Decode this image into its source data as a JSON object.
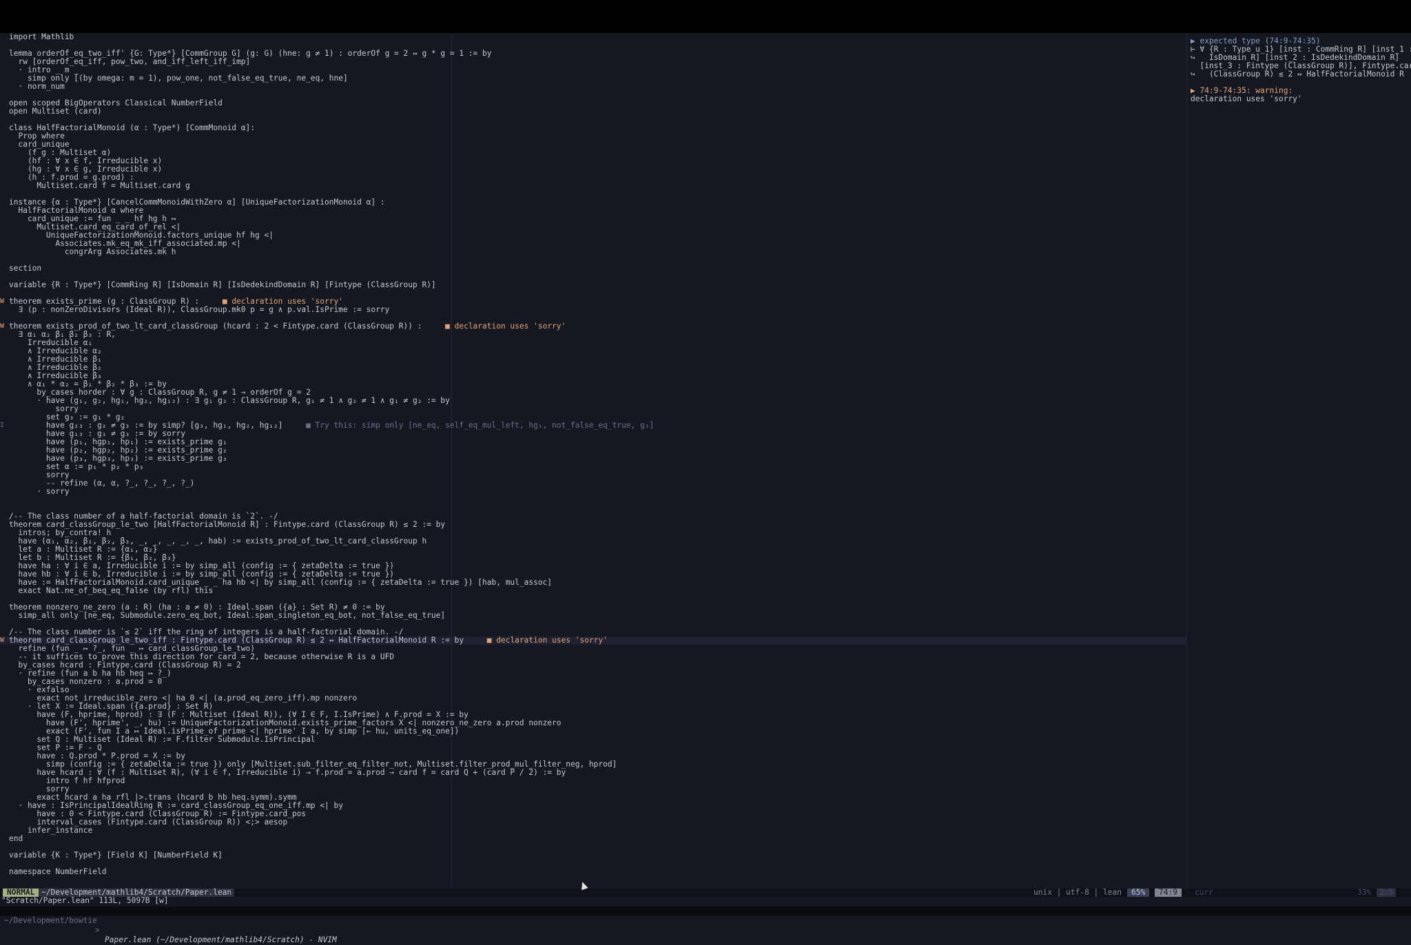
{
  "editor": {
    "lines": [
      {
        "s": "",
        "c": "import Mathlib",
        "d": ""
      },
      {
        "s": "",
        "c": "",
        "d": ""
      },
      {
        "s": "",
        "c": "lemma orderOf_eq_two_iff' {G: Type*} [CommGroup G] (g: G) (hne: g ≠ 1) : orderOf g = 2 ↔ g * g = 1 := by",
        "d": ""
      },
      {
        "s": "",
        "c": "  rw [orderOf_eq_iff, pow_two, and_iff_left_iff_imp]",
        "d": ""
      },
      {
        "s": "",
        "c": "  · intro _ m _",
        "d": ""
      },
      {
        "s": "",
        "c": "    simp only [(by omega: m = 1), pow_one, not_false_eq_true, ne_eq, hne]",
        "d": ""
      },
      {
        "s": "",
        "c": "  · norm_num",
        "d": ""
      },
      {
        "s": "",
        "c": "",
        "d": ""
      },
      {
        "s": "",
        "c": "open scoped BigOperators Classical NumberField",
        "d": ""
      },
      {
        "s": "",
        "c": "open Multiset (card)",
        "d": ""
      },
      {
        "s": "",
        "c": "",
        "d": ""
      },
      {
        "s": "",
        "c": "class HalfFactorialMonoid (α : Type*) [CommMonoid α]:",
        "d": ""
      },
      {
        "s": "",
        "c": "  Prop where",
        "d": ""
      },
      {
        "s": "",
        "c": "  card_unique",
        "d": ""
      },
      {
        "s": "",
        "c": "    (f g : Multiset α)",
        "d": ""
      },
      {
        "s": "",
        "c": "    (hf : ∀ x ∈ f, Irreducible x)",
        "d": ""
      },
      {
        "s": "",
        "c": "    (hg : ∀ x ∈ g, Irreducible x)",
        "d": ""
      },
      {
        "s": "",
        "c": "    (h : f.prod = g.prod) :",
        "d": ""
      },
      {
        "s": "",
        "c": "      Multiset.card f = Multiset.card g",
        "d": ""
      },
      {
        "s": "",
        "c": "",
        "d": ""
      },
      {
        "s": "",
        "c": "instance {α : Type*} [CancelCommMonoidWithZero α] [UniqueFactorizationMonoid α] :",
        "d": ""
      },
      {
        "s": "",
        "c": "  HalfFactorialMonoid α where",
        "d": ""
      },
      {
        "s": "",
        "c": "    card_unique := fun _ _ hf hg h ↦",
        "d": ""
      },
      {
        "s": "",
        "c": "      Multiset.card_eq_card_of_rel <|",
        "d": ""
      },
      {
        "s": "",
        "c": "        UniqueFactorizationMonoid.factors_unique hf hg <|",
        "d": ""
      },
      {
        "s": "",
        "c": "          Associates.mk_eq_mk_iff_associated.mp <|",
        "d": ""
      },
      {
        "s": "",
        "c": "            congrArg Associates.mk h",
        "d": ""
      },
      {
        "s": "",
        "c": "",
        "d": ""
      },
      {
        "s": "",
        "c": "section",
        "d": ""
      },
      {
        "s": "",
        "c": "",
        "d": ""
      },
      {
        "s": "",
        "c": "variable {R : Type*} [CommRing R] [IsDomain R] [IsDedekindDomain R] [Fintype (ClassGroup R)]",
        "d": ""
      },
      {
        "s": "",
        "c": "",
        "d": ""
      },
      {
        "s": "W",
        "c": "theorem exists_prime (g : ClassGroup R) :     ",
        "d": "■ declaration uses 'sorry'"
      },
      {
        "s": "",
        "c": "  ∃ (p : nonZeroDivisors (Ideal R)), ClassGroup.mk0 p = g ∧ p.val.IsPrime := sorry",
        "d": ""
      },
      {
        "s": "",
        "c": "",
        "d": ""
      },
      {
        "s": "W",
        "c": "theorem exists_prod_of_two_lt_card_classGroup (hcard : 2 < Fintype.card (ClassGroup R)) :     ",
        "d": "■ declaration uses 'sorry'"
      },
      {
        "s": "",
        "c": "  ∃ α₁ α₂ β₁ β₂ β₃ : R,",
        "d": ""
      },
      {
        "s": "",
        "c": "    Irreducible α₁",
        "d": ""
      },
      {
        "s": "",
        "c": "    ∧ Irreducible α₂",
        "d": ""
      },
      {
        "s": "",
        "c": "    ∧ Irreducible β₁",
        "d": ""
      },
      {
        "s": "",
        "c": "    ∧ Irreducible β₂",
        "d": ""
      },
      {
        "s": "",
        "c": "    ∧ Irreducible β₃",
        "d": ""
      },
      {
        "s": "",
        "c": "    ∧ α₁ * α₂ = β₁ * β₂ * β₃ := by",
        "d": ""
      },
      {
        "s": "",
        "c": "      by_cases horder : ∀ g : ClassGroup R, g ≠ 1 → orderOf g = 2",
        "d": ""
      },
      {
        "s": "",
        "c": "      · have (g₁, g₂, hg₁, hg₂, hg₁₂) : ∃ g₁ g₂ : ClassGroup R, g₁ ≠ 1 ∧ g₂ ≠ 1 ∧ g₁ ≠ g₂ := by",
        "d": ""
      },
      {
        "s": "",
        "c": "          sorry",
        "d": ""
      },
      {
        "s": "",
        "c": "        set g₃ := g₁ * g₂",
        "d": ""
      },
      {
        "s": "I",
        "c": "        have g₂₃ : g₂ ≠ g₃ := by simp? [g₃, hg₁, hg₂, hg₁₂]     ",
        "d": "■ Try this: simp only [ne_eq, self_eq_mul_left, hg₁, not_false_eq_true, g₃]"
      },
      {
        "s": "",
        "c": "        have g₁₃ : g₁ ≠ g₃ := by sorry",
        "d": ""
      },
      {
        "s": "",
        "c": "        have (p₁, hgp₁, hp₁) := exists_prime g₁",
        "d": ""
      },
      {
        "s": "",
        "c": "        have (p₂, hgp₂, hp₂) := exists_prime g₂",
        "d": ""
      },
      {
        "s": "",
        "c": "        have (p₃, hgp₃, hp₃) := exists_prime g₃",
        "d": ""
      },
      {
        "s": "",
        "c": "        set α := p₁ * p₂ * p₃",
        "d": ""
      },
      {
        "s": "",
        "c": "        sorry",
        "d": ""
      },
      {
        "s": "",
        "c": "        -- refine (α, α, ?_, ?_, ?_, ?_)",
        "d": ""
      },
      {
        "s": "",
        "c": "      · sorry",
        "d": ""
      },
      {
        "s": "",
        "c": "",
        "d": ""
      },
      {
        "s": "",
        "c": "",
        "d": ""
      },
      {
        "s": "",
        "c": "/-- The class number of a half-factorial domain is `2`. -/",
        "d": ""
      },
      {
        "s": "",
        "c": "theorem card_classGroup_le_two [HalfFactorialMonoid R] : Fintype.card (ClassGroup R) ≤ 2 := by",
        "d": ""
      },
      {
        "s": "",
        "c": "  intros; by_contra! h",
        "d": ""
      },
      {
        "s": "",
        "c": "  have (α₁, α₂, β₁, β₂, β₃, _, _, _, _, _, hab) := exists_prod_of_two_lt_card_classGroup h",
        "d": ""
      },
      {
        "s": "",
        "c": "  let a : Multiset R := {α₁, α₂}",
        "d": ""
      },
      {
        "s": "",
        "c": "  let b : Multiset R := {β₁, β₂, β₃}",
        "d": ""
      },
      {
        "s": "",
        "c": "  have ha : ∀ i ∈ a, Irreducible i := by simp_all (config := { zetaDelta := true })",
        "d": ""
      },
      {
        "s": "",
        "c": "  have hb : ∀ i ∈ b, Irreducible i := by simp_all (config := { zetaDelta := true })",
        "d": ""
      },
      {
        "s": "",
        "c": "  have := HalfFactorialMonoid.card_unique _ _ ha hb <| by simp_all (config := { zetaDelta := true }) [hab, mul_assoc]",
        "d": ""
      },
      {
        "s": "",
        "c": "  exact Nat.ne_of_beq_eq_false (by rfl) this",
        "d": ""
      },
      {
        "s": "",
        "c": "",
        "d": ""
      },
      {
        "s": "",
        "c": "theorem nonzero_ne_zero (a : R) (ha : a ≠ 0) : Ideal.span ({a} : Set R) ≠ 0 := by",
        "d": ""
      },
      {
        "s": "",
        "c": "  simp_all only [ne_eq, Submodule.zero_eq_bot, Ideal.span_singleton_eq_bot, not_false_eq_true]",
        "d": ""
      },
      {
        "s": "",
        "c": "",
        "d": ""
      },
      {
        "s": "",
        "c": "/-- The class number is `≤ 2` iff the ring of integers is a half-factorial domain. -/",
        "d": ""
      },
      {
        "s": "W",
        "c": "theorem card_classGroup_le_two_iff : Fintype.card (ClassGroup R) ≤ 2 ↔ HalfFactorialMonoid R := by     ",
        "d": "■ declaration uses 'sorry'",
        "cur": true
      },
      {
        "s": "",
        "c": "  refine (fun _ ↦ ?_, fun _ ↦ card_classGroup_le_two)",
        "d": ""
      },
      {
        "s": "",
        "c": "  -- it suffices to prove this direction for card = 2, because otherwise R is a UFD",
        "d": ""
      },
      {
        "s": "",
        "c": "  by_cases hcard : Fintype.card (ClassGroup R) = 2",
        "d": ""
      },
      {
        "s": "",
        "c": "  · refine (fun a b ha hb heq ↦ ?_)",
        "d": ""
      },
      {
        "s": "",
        "c": "    by_cases nonzero : a.prod = 0",
        "d": ""
      },
      {
        "s": "",
        "c": "    · exfalso",
        "d": ""
      },
      {
        "s": "",
        "c": "      exact not_irreducible_zero <| ha 0 <| (a.prod_eq_zero_iff).mp nonzero",
        "d": ""
      },
      {
        "s": "",
        "c": "    · let X := Ideal.span ({a.prod} : Set R)",
        "d": ""
      },
      {
        "s": "",
        "c": "      have (F, hprime, hprod) : ∃ (F : Multiset (Ideal R)), (∀ I ∈ F, I.IsPrime) ∧ F.prod = X := by",
        "d": ""
      },
      {
        "s": "",
        "c": "        have (F', hprime', _, hu) := UniqueFactorizationMonoid.exists_prime_factors X <| nonzero_ne_zero a.prod nonzero",
        "d": ""
      },
      {
        "s": "",
        "c": "        exact (F', fun I a ↦ Ideal.isPrime_of_prime <| hprime' I a, by simp [← hu, units_eq_one])",
        "d": ""
      },
      {
        "s": "",
        "c": "      set Q : Multiset (Ideal R) := F.filter Submodule.IsPrincipal",
        "d": ""
      },
      {
        "s": "",
        "c": "      set P := F - Q",
        "d": ""
      },
      {
        "s": "",
        "c": "      have : Q.prod * P.prod = X := by",
        "d": ""
      },
      {
        "s": "",
        "c": "        simp (config := { zetaDelta := true }) only [Multiset.sub_filter_eq_filter_not, Multiset.filter_prod_mul_filter_neg, hprod]",
        "d": ""
      },
      {
        "s": "",
        "c": "      have hcard : ∀ (f : Multiset R), (∀ i ∈ f, Irreducible i) → f.prod = a.prod → card f = card Q + (card P / 2) := by",
        "d": ""
      },
      {
        "s": "",
        "c": "        intro f hf hfprod",
        "d": ""
      },
      {
        "s": "",
        "c": "        sorry",
        "d": ""
      },
      {
        "s": "",
        "c": "      exact hcard a ha rfl |>.trans (hcard b hb heq.symm).symm",
        "d": ""
      },
      {
        "s": "",
        "c": "  · have : IsPrincipalIdealRing R := card_classGroup_eq_one_iff.mp <| by",
        "d": ""
      },
      {
        "s": "",
        "c": "      have : 0 < Fintype.card (ClassGroup R) := Fintype.card_pos",
        "d": ""
      },
      {
        "s": "",
        "c": "      interval_cases (Fintype.card (ClassGroup R)) <;> aesop",
        "d": ""
      },
      {
        "s": "",
        "c": "    infer_instance",
        "d": ""
      },
      {
        "s": "",
        "c": "end",
        "d": ""
      },
      {
        "s": "",
        "c": "",
        "d": ""
      },
      {
        "s": "",
        "c": "variable {K : Type*} [Field K] [NumberField K]",
        "d": ""
      },
      {
        "s": "",
        "c": "",
        "d": ""
      },
      {
        "s": "",
        "c": "namespace NumberField",
        "d": ""
      }
    ]
  },
  "infoview": {
    "lines": [
      {
        "t": "▶ expected type (74:9-74:35)",
        "k": "h"
      },
      {
        "t": "⊢ ∀ {R : Type u_1} [inst : CommRing R] [inst_1 :",
        "k": ""
      },
      {
        "t": "↪   IsDomain R] [inst_2 : IsDedekindDomain R]",
        "k": ""
      },
      {
        "t": "  [inst_3 : Fintype (ClassGroup R)], Fintype.card",
        "k": ""
      },
      {
        "t": "↪   (ClassGroup R) ≤ 2 ↔ HalfFactorialMonoid R",
        "k": ""
      },
      {
        "t": "",
        "k": ""
      },
      {
        "t": "▶ 74:9-74:35: warning:",
        "k": "warn"
      },
      {
        "t": "declaration uses 'sorry'",
        "k": ""
      }
    ]
  },
  "status": {
    "mode": "NORMAL",
    "path": "~/Development/mathlib4/Scratch/Paper.lean",
    "info": "unix | utf-8 | lean",
    "percent": "65%",
    "position": "74:9",
    "right_label": "curr",
    "right_percent": "33%",
    "right_position": "2:5"
  },
  "cmdline": "\"Scratch/Paper.lean\" 113L, 5097B [w]",
  "titlebar": {
    "path": "~/Development/bowtie",
    "separator": ">",
    "title": "Paper.lean (~/Development/mathlib4/Scratch) - NVIM"
  }
}
